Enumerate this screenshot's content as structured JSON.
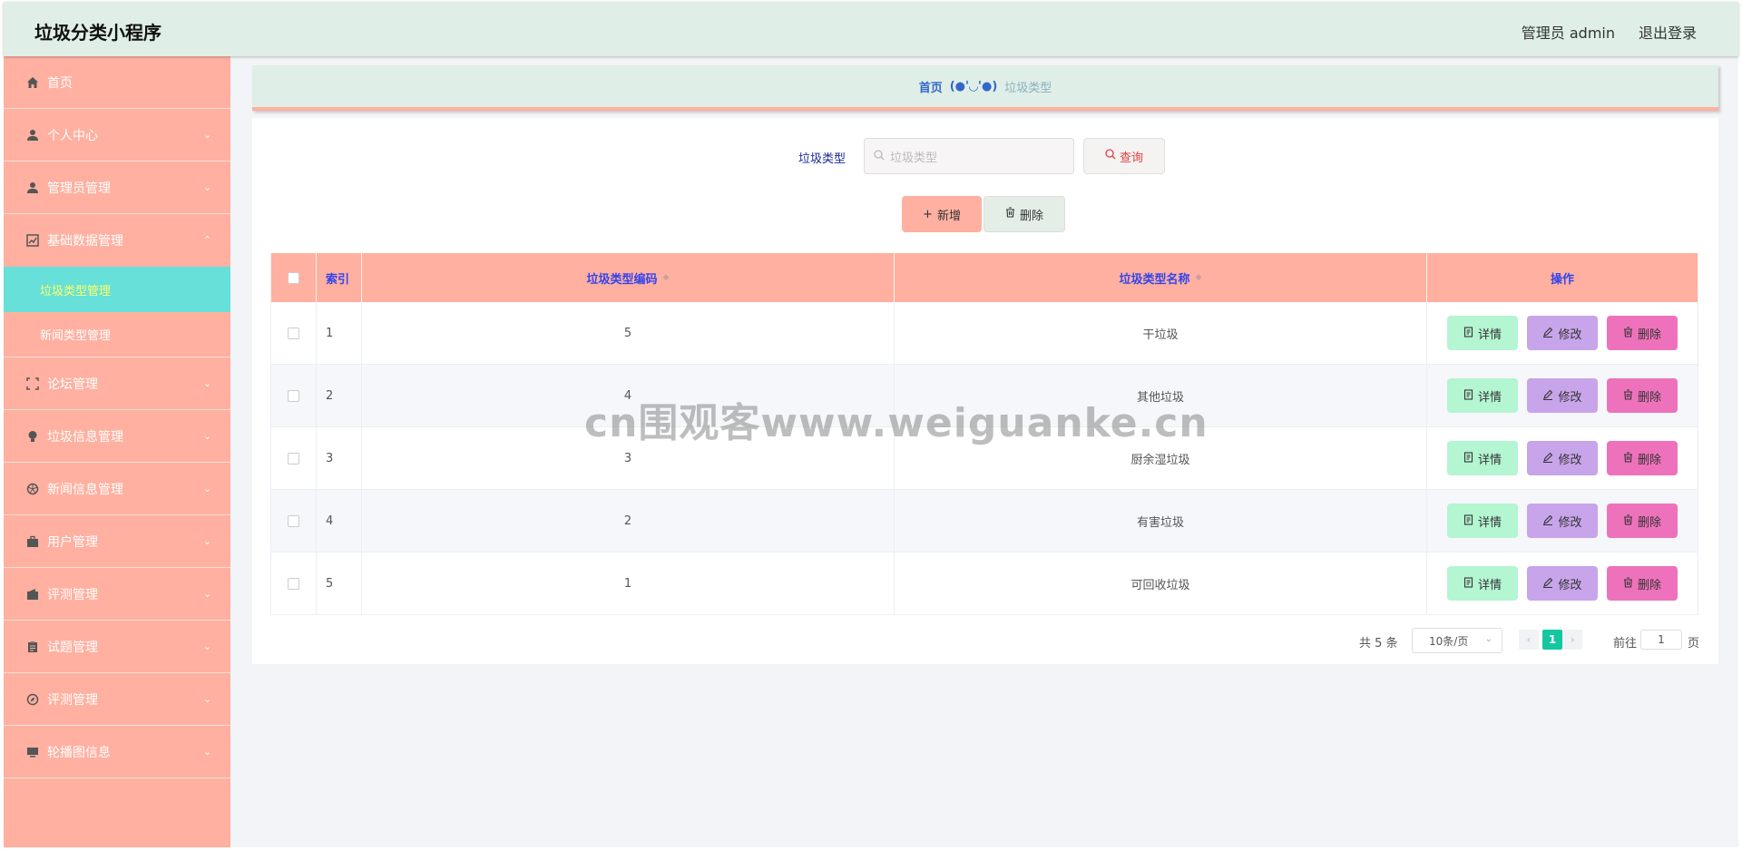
{
  "header": {
    "title": "垃圾分类小程序",
    "user": "管理员 admin",
    "logout": "退出登录"
  },
  "sidebar": {
    "items": [
      {
        "label": "首页",
        "icon": "home-icon"
      },
      {
        "label": "个人中心",
        "icon": "user-icon"
      },
      {
        "label": "管理员管理",
        "icon": "user-icon"
      },
      {
        "label": "基础数据管理",
        "icon": "chart-icon"
      },
      {
        "label": "论坛管理",
        "icon": "scan-icon"
      },
      {
        "label": "垃圾信息管理",
        "icon": "bulb-icon"
      },
      {
        "label": "新闻信息管理",
        "icon": "aperture-icon"
      },
      {
        "label": "用户管理",
        "icon": "briefcase-icon"
      },
      {
        "label": "评测管理",
        "icon": "wallet-icon"
      },
      {
        "label": "试题管理",
        "icon": "clipboard-icon"
      },
      {
        "label": "评测管理",
        "icon": "compass-icon"
      },
      {
        "label": "轮播图信息",
        "icon": "monitor-icon"
      }
    ],
    "subitems": [
      {
        "label": "垃圾类型管理"
      },
      {
        "label": "新闻类型管理"
      }
    ]
  },
  "breadcrumb": {
    "home": "首页",
    "separator": "(●'◡'●)",
    "current": "垃圾类型"
  },
  "search": {
    "label": "垃圾类型",
    "placeholder": "垃圾类型",
    "button": "查询"
  },
  "actions": {
    "add": "新增",
    "delete": "删除"
  },
  "table": {
    "headers": {
      "index": "索引",
      "code": "垃圾类型编码",
      "name": "垃圾类型名称",
      "ops": "操作"
    },
    "rows": [
      {
        "index": "1",
        "code": "5",
        "name": "干垃圾"
      },
      {
        "index": "2",
        "code": "4",
        "name": "其他垃圾"
      },
      {
        "index": "3",
        "code": "3",
        "name": "厨余湿垃圾"
      },
      {
        "index": "4",
        "code": "2",
        "name": "有害垃圾"
      },
      {
        "index": "5",
        "code": "1",
        "name": "可回收垃圾"
      }
    ],
    "op_labels": {
      "detail": "详情",
      "edit": "修改",
      "delete": "删除"
    }
  },
  "pagination": {
    "total": "共 5 条",
    "page_size": "10条/页",
    "current_page": "1",
    "goto": "前往",
    "goto_value": "1",
    "page": "页"
  },
  "watermark": "cn围观客www.weiguanke.cn",
  "colors": {
    "header_bg": "#dfeee6",
    "sidebar_bg": "#ffb0a0",
    "active_sub_bg": "#66e0d8",
    "table_head_bg": "#ffb0a0",
    "detail_btn": "#b4f5d2",
    "edit_btn": "#c8a4ea",
    "delete_btn": "#ee72bb",
    "page_active": "#13c7a0"
  }
}
